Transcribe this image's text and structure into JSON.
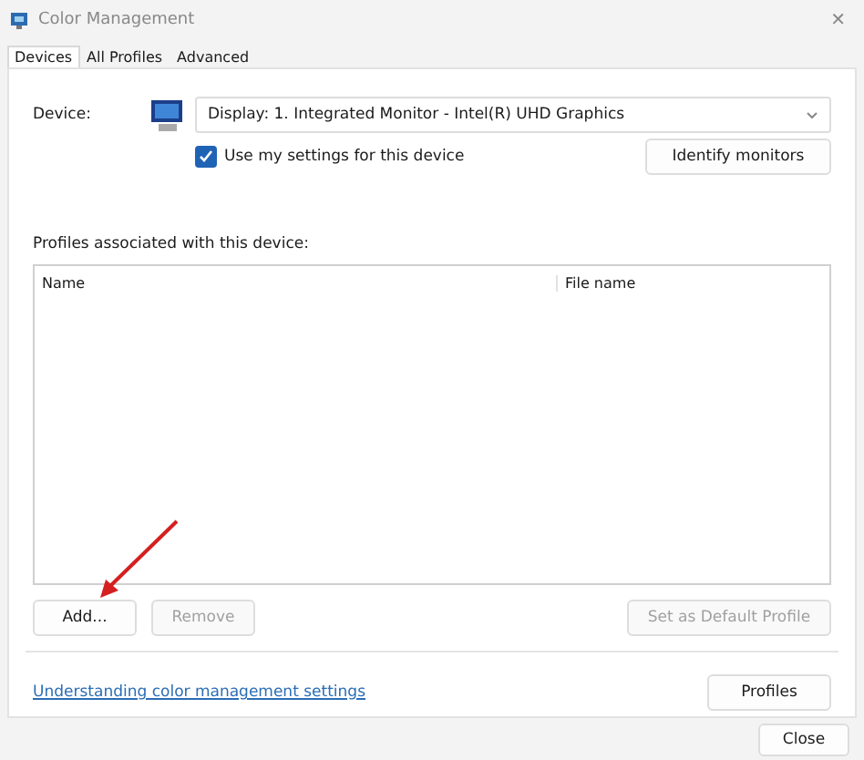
{
  "window": {
    "title": "Color Management",
    "close": "✕"
  },
  "tabs": [
    {
      "label": "Devices",
      "selected": true
    },
    {
      "label": "All Profiles",
      "selected": false
    },
    {
      "label": "Advanced",
      "selected": false
    }
  ],
  "device": {
    "label": "Device:",
    "value": "Display: 1. Integrated Monitor - Intel(R) UHD Graphics",
    "use_my_settings": {
      "label": "Use my settings for this device",
      "checked": true
    },
    "identify_button": "Identify monitors"
  },
  "profiles": {
    "label": "Profiles associated with this device:",
    "columns": [
      "Name",
      "File name"
    ]
  },
  "buttons": [
    {
      "label": "Add...",
      "disabled": false
    },
    {
      "label": "Remove",
      "disabled": true
    },
    {
      "label": "Set as Default Profile",
      "disabled": true
    }
  ],
  "link": "Understanding color management settings",
  "profiles_button": "Profiles",
  "close_button": "Close"
}
